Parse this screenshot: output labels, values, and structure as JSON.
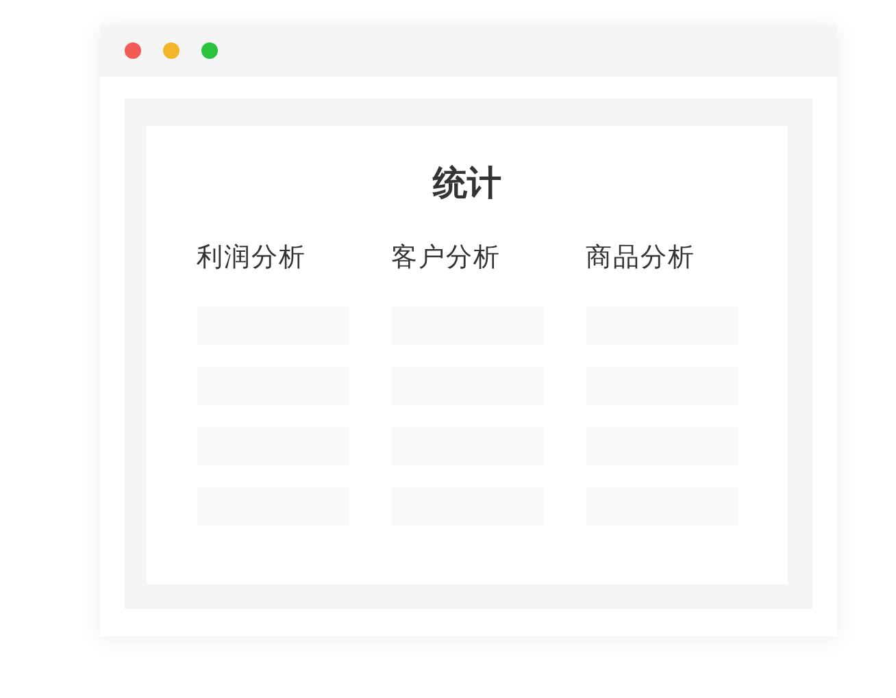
{
  "window": {
    "controls": [
      {
        "kind": "close"
      },
      {
        "kind": "minimize"
      },
      {
        "kind": "maximize"
      }
    ]
  },
  "card": {
    "title": "统计",
    "columns": [
      {
        "label": "利润分析"
      },
      {
        "label": "客户分析"
      },
      {
        "label": "商品分析"
      }
    ]
  }
}
